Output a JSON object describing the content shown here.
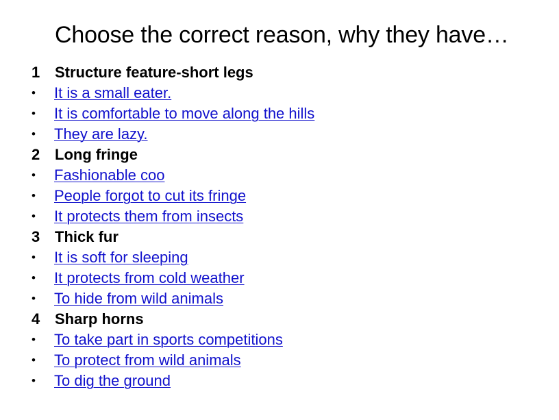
{
  "slide": {
    "title": "Choose the correct reason, why they have…",
    "bullet_glyph": "•",
    "link_color": "#1111CC",
    "text_color": "#000000",
    "background_color": "#FFFFFF"
  },
  "sections": [
    {
      "number": "1",
      "title": "Structure feature-short legs",
      "options": [
        "It is a small eater.",
        "It is comfortable to move along the hills",
        "They are lazy."
      ]
    },
    {
      "number": "2",
      "title": "Long fringe",
      "options": [
        "Fashionable coo",
        "People forgot to cut its fringe",
        "It protects them from insects"
      ]
    },
    {
      "number": "3",
      "title": "Thick fur",
      "options": [
        "It is soft for sleeping",
        "It protects from cold weather",
        "To hide from wild animals"
      ]
    },
    {
      "number": "4",
      "title": "Sharp horns",
      "options": [
        "To take part in sports competitions",
        "To protect from wild animals",
        "To dig the ground"
      ]
    }
  ]
}
